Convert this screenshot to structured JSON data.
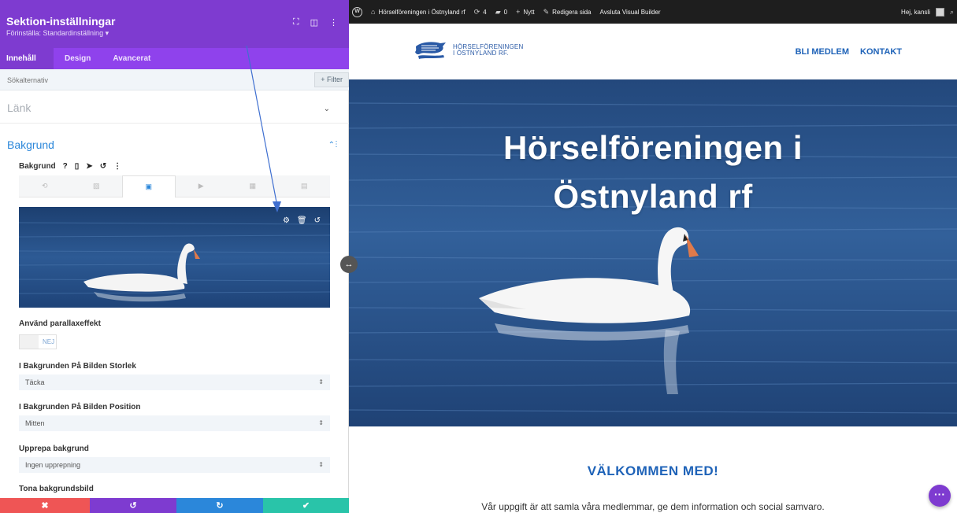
{
  "panel": {
    "title": "Sektion-inställningar",
    "preset": "Förinställa: Standardinställning ▾",
    "header_icons": [
      "⛶",
      "◫",
      "⋮"
    ],
    "tabs": [
      {
        "label": "Innehåll",
        "active": true
      },
      {
        "label": "Design",
        "active": false
      },
      {
        "label": "Avancerat",
        "active": false
      }
    ],
    "search_placeholder": "Sökalternativ",
    "filter_label": "+ Filter",
    "link_section": "Länk",
    "bg_section": "Bakgrund",
    "bg_label": "Bakgrund",
    "bg_label_icons": [
      "?",
      "▯",
      "➤",
      "↺",
      "⋮"
    ],
    "bg_types": [
      "color-fill-icon",
      "gradient-icon",
      "image-icon",
      "video-icon",
      "pattern-icon",
      "mask-icon"
    ],
    "bg_type_glyphs": [
      "⟲",
      "▨",
      "▣",
      "▶",
      "▦",
      "▤"
    ],
    "preview_tools": [
      "⚙",
      "🗑",
      "↺"
    ],
    "parallax_label": "Använd parallaxeffekt",
    "parallax_value": "NEJ",
    "size_label": "I Bakgrunden På Bilden Storlek",
    "size_value": "Täcka",
    "position_label": "I Bakgrunden På Bilden Position",
    "position_value": "Mitten",
    "repeat_label": "Upprepa bakgrund",
    "repeat_value": "Ingen upprepning",
    "fade_label": "Tona bakgrundsbild",
    "select_arrow": "⇕",
    "actions": [
      {
        "glyph": "✖",
        "color": "#ef5555"
      },
      {
        "glyph": "↺",
        "color": "#7e3bd0"
      },
      {
        "glyph": "↻",
        "color": "#2b87da"
      },
      {
        "glyph": "✔",
        "color": "#29c4a9"
      }
    ]
  },
  "adminbar": {
    "site_name": "Hörselföreningen i Östnyland rf",
    "updates": "4",
    "comments": "0",
    "new_label": "Nytt",
    "edit_label": "Redigera sida",
    "exit_label": "Avsluta Visual Builder",
    "greeting": "Hej, kansli",
    "search_glyph": "⌕"
  },
  "site": {
    "logo_line1": "HÖRSELFÖRENINGEN",
    "logo_line2": "I ÖSTNYLAND RF.",
    "nav": [
      "BLI MEDLEM",
      "KONTAKT"
    ],
    "hero_line1": "Hörselföreningen i",
    "hero_line2": "Östnyland rf",
    "welcome": "VÄLKOMMEN MED!",
    "intro": "Vår uppgift är att samla våra medlemmar, ge dem information och social samvaro.",
    "fab_glyph": "···",
    "resize_glyph": "↔"
  },
  "colors": {
    "accent_purple": "#7e3bd0",
    "tab_purple": "#8f42ec",
    "link_blue": "#2b87da",
    "site_blue": "#1f63b8",
    "water": "#274f83"
  }
}
